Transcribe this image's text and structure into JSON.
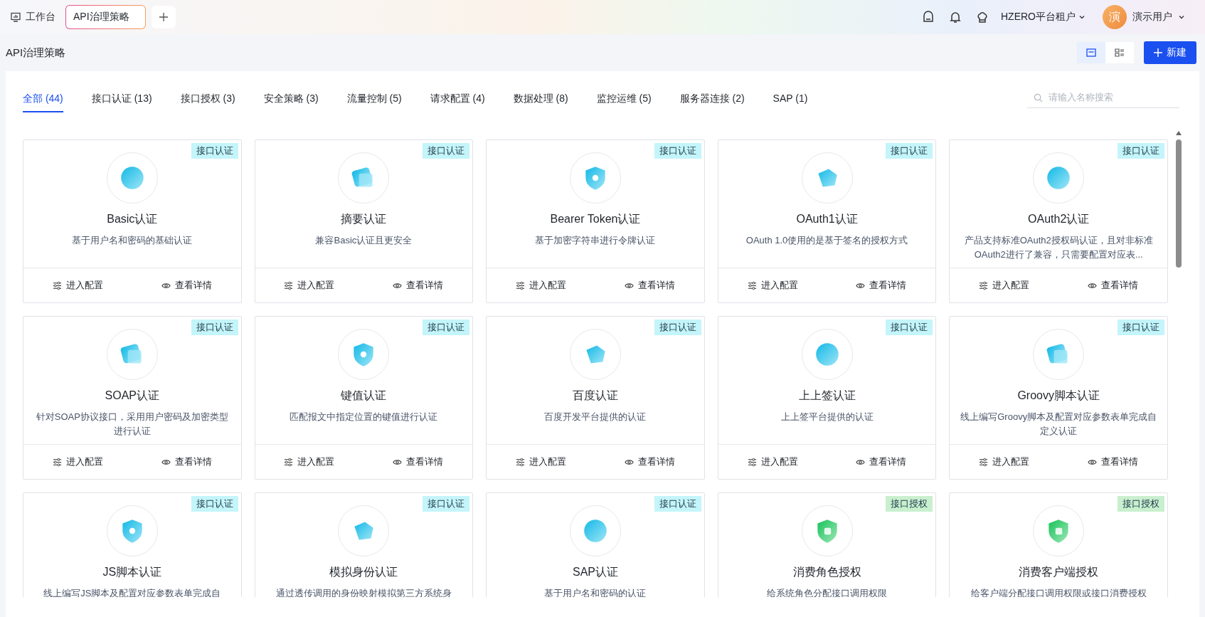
{
  "top_bar": {
    "workbench": "工作台",
    "tabs": [
      {
        "label": "API治理策略",
        "selected": true
      }
    ],
    "tenant": "HZERO平台租户",
    "avatar": "演",
    "user": "演示用户"
  },
  "page": {
    "title": "API治理策略",
    "views": [
      {
        "selected": true
      },
      {
        "selected": false
      }
    ],
    "new_button": "新建"
  },
  "filters": [
    {
      "label": "全部 (44)",
      "selected": true
    },
    {
      "label": "接口认证 (13)",
      "selected": false
    },
    {
      "label": "接口授权 (3)",
      "selected": false
    },
    {
      "label": "安全策略 (3)",
      "selected": false
    },
    {
      "label": "流量控制 (5)",
      "selected": false
    },
    {
      "label": "请求配置 (4)",
      "selected": false
    },
    {
      "label": "数据处理 (8)",
      "selected": false
    },
    {
      "label": "监控运维 (5)",
      "selected": false
    },
    {
      "label": "服务器连接 (2)",
      "selected": false
    },
    {
      "label": "SAP (1)",
      "selected": false
    }
  ],
  "search": {
    "placeholder": "请输入名称搜索"
  },
  "cards": [
    {
      "tag": "接口认证",
      "color": "#c4f5fa",
      "title": "Basic认证",
      "description": "基于用户名和密码的基础认证",
      "actions": [
        "进入配置",
        "查看详情"
      ]
    },
    {
      "tag": "接口认证",
      "color": "#c4f5fa",
      "title": "摘要认证",
      "description": "兼容Basic认证且更安全",
      "actions": [
        "进入配置",
        "查看详情"
      ]
    },
    {
      "tag": "接口认证",
      "color": "#c4f5fa",
      "title": "Bearer Token认证",
      "description": "基于加密字符串进行令牌认证",
      "actions": [
        "进入配置",
        "查看详情"
      ]
    },
    {
      "tag": "接口认证",
      "color": "#c4f5fa",
      "title": "OAuth1认证",
      "description": "OAuth 1.0使用的是基于签名的授权方式",
      "actions": [
        "进入配置",
        "查看详情"
      ]
    },
    {
      "tag": "接口认证",
      "color": "#c4f5fa",
      "title": "OAuth2认证",
      "description": "产品支持标准OAuth2授权码认证，且对非标准OAuth2进行了兼容，只需要配置对应表...",
      "actions": [
        "进入配置",
        "查看详情"
      ]
    },
    {
      "tag": "接口认证",
      "color": "#c4f5fa",
      "title": "SOAP认证",
      "description": "针对SOAP协议接口，采用用户密码及加密类型进行认证",
      "actions": [
        "进入配置",
        "查看详情"
      ]
    },
    {
      "tag": "接口认证",
      "color": "#c4f5fa",
      "title": "键值认证",
      "description": "匹配报文中指定位置的键值进行认证",
      "actions": [
        "进入配置",
        "查看详情"
      ]
    },
    {
      "tag": "接口认证",
      "color": "#c4f5fa",
      "title": "百度认证",
      "description": "百度开发平台提供的认证",
      "actions": [
        "进入配置",
        "查看详情"
      ]
    },
    {
      "tag": "接口认证",
      "color": "#c4f5fa",
      "title": "上上签认证",
      "description": "上上签平台提供的认证",
      "actions": [
        "进入配置",
        "查看详情"
      ]
    },
    {
      "tag": "接口认证",
      "color": "#c4f5fa",
      "title": "Groovy脚本认证",
      "description": "线上编写Groovy脚本及配置对应参数表单完成自定义认证",
      "actions": [
        "进入配置",
        "查看详情"
      ]
    },
    {
      "tag": "接口认证",
      "color": "#c4f5fa",
      "title": "JS脚本认证",
      "description": "线上编写JS脚本及配置对应参数表单完成自"
    },
    {
      "tag": "接口认证",
      "color": "#c4f5fa",
      "title": "模拟身份认证",
      "description": "通过透传调用的身份映射模拟第三方系统身"
    },
    {
      "tag": "接口认证",
      "color": "#c4f5fa",
      "title": "SAP认证",
      "description": "基于用户名和密码的认证"
    },
    {
      "tag": "接口授权",
      "color": "#c8f0cf",
      "title": "消费角色授权",
      "description": "给系统角色分配接口调用权限"
    },
    {
      "tag": "接口授权",
      "color": "#c8f0cf",
      "title": "消费客户端授权",
      "description": "给客户端分配接口调用权限或接口消费授权"
    }
  ]
}
